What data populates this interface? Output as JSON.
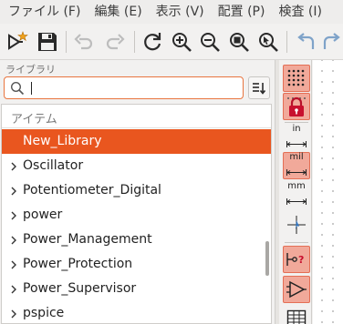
{
  "menubar": {
    "items": [
      "ファイル (F)",
      "編集 (E)",
      "表示 (V)",
      "配置 (P)",
      "検査 (I)"
    ]
  },
  "toolbar": {
    "buttons": [
      "new-symbol-icon",
      "save-icon",
      "undo-icon",
      "redo-icon",
      "refresh-icon",
      "zoom-in-icon",
      "zoom-out-icon",
      "zoom-fit-icon",
      "zoom-selection-icon",
      "rotate-ccw-icon",
      "rotate-cw-icon"
    ]
  },
  "library": {
    "title": "ライブラリ",
    "search": {
      "value": "",
      "placeholder": ""
    },
    "column_header": "アイテム",
    "items": [
      {
        "label": "New_Library",
        "selected": true
      },
      {
        "label": "Oscillator",
        "selected": false
      },
      {
        "label": "Potentiometer_Digital",
        "selected": false
      },
      {
        "label": "power",
        "selected": false
      },
      {
        "label": "Power_Management",
        "selected": false
      },
      {
        "label": "Power_Protection",
        "selected": false
      },
      {
        "label": "Power_Supervisor",
        "selected": false
      },
      {
        "label": "pspice",
        "selected": false
      }
    ]
  },
  "side_toolbar": {
    "inch_label": "in",
    "mil_label": "mil",
    "mm_label": "mm",
    "active_unit": "mil"
  },
  "colors": {
    "accent": "#e9561f",
    "toggle_on": "#f1a99a",
    "search_focus": "#e9753f"
  }
}
